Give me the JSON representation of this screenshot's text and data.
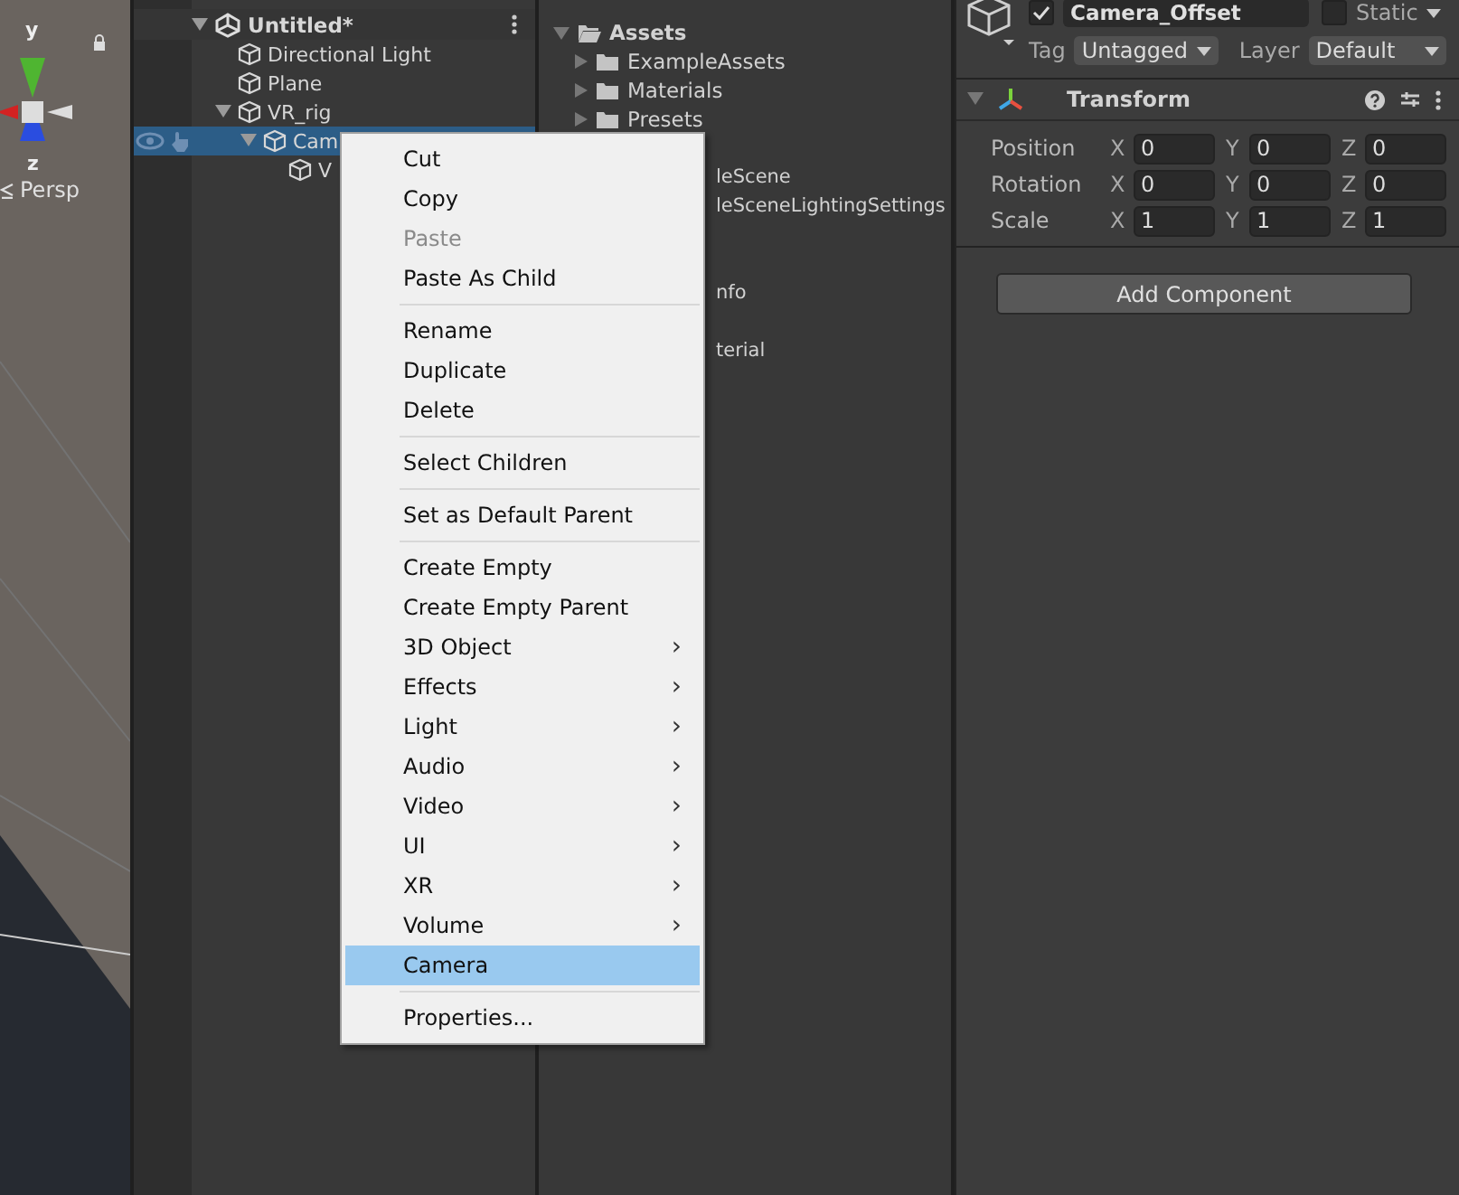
{
  "scene": {
    "axis_labels": [
      "y",
      "z"
    ],
    "projection": "Persp"
  },
  "hierarchy": {
    "scene": "Untitled*",
    "items": [
      {
        "label": "Directional Light",
        "selected": false
      },
      {
        "label": "Plane",
        "selected": false
      },
      {
        "label": "VR_rig",
        "expanded": true,
        "selected": false,
        "children": [
          {
            "label": "Cam",
            "expanded": true,
            "selected": true,
            "children": [
              {
                "label": "V",
                "selected": false
              }
            ]
          }
        ]
      }
    ]
  },
  "project": {
    "root": "Assets",
    "folders": [
      "ExampleAssets",
      "Materials",
      "Presets"
    ],
    "partial_items": [
      "leScene",
      "leSceneLightingSettings",
      "nfo",
      "terial"
    ]
  },
  "context_menu": [
    {
      "kind": "item",
      "label": "Cut",
      "disabled": false,
      "submenu": false,
      "selected": false
    },
    {
      "kind": "item",
      "label": "Copy",
      "disabled": false,
      "submenu": false,
      "selected": false
    },
    {
      "kind": "item",
      "label": "Paste",
      "disabled": true,
      "submenu": false,
      "selected": false
    },
    {
      "kind": "item",
      "label": "Paste As Child",
      "disabled": false,
      "submenu": false,
      "selected": false
    },
    {
      "kind": "separator"
    },
    {
      "kind": "item",
      "label": "Rename",
      "disabled": false,
      "submenu": false,
      "selected": false
    },
    {
      "kind": "item",
      "label": "Duplicate",
      "disabled": false,
      "submenu": false,
      "selected": false
    },
    {
      "kind": "item",
      "label": "Delete",
      "disabled": false,
      "submenu": false,
      "selected": false
    },
    {
      "kind": "separator"
    },
    {
      "kind": "item",
      "label": "Select Children",
      "disabled": false,
      "submenu": false,
      "selected": false
    },
    {
      "kind": "separator"
    },
    {
      "kind": "item",
      "label": "Set as Default Parent",
      "disabled": false,
      "submenu": false,
      "selected": false
    },
    {
      "kind": "separator"
    },
    {
      "kind": "item",
      "label": "Create Empty",
      "disabled": false,
      "submenu": false,
      "selected": false
    },
    {
      "kind": "item",
      "label": "Create Empty Parent",
      "disabled": false,
      "submenu": false,
      "selected": false
    },
    {
      "kind": "item",
      "label": "3D Object",
      "disabled": false,
      "submenu": true,
      "selected": false
    },
    {
      "kind": "item",
      "label": "Effects",
      "disabled": false,
      "submenu": true,
      "selected": false
    },
    {
      "kind": "item",
      "label": "Light",
      "disabled": false,
      "submenu": true,
      "selected": false
    },
    {
      "kind": "item",
      "label": "Audio",
      "disabled": false,
      "submenu": true,
      "selected": false
    },
    {
      "kind": "item",
      "label": "Video",
      "disabled": false,
      "submenu": true,
      "selected": false
    },
    {
      "kind": "item",
      "label": "UI",
      "disabled": false,
      "submenu": true,
      "selected": false
    },
    {
      "kind": "item",
      "label": "XR",
      "disabled": false,
      "submenu": true,
      "selected": false
    },
    {
      "kind": "item",
      "label": "Volume",
      "disabled": false,
      "submenu": true,
      "selected": false
    },
    {
      "kind": "item",
      "label": "Camera",
      "disabled": false,
      "submenu": false,
      "selected": true
    },
    {
      "kind": "separator"
    },
    {
      "kind": "item",
      "label": "Properties...",
      "disabled": false,
      "submenu": false,
      "selected": false
    }
  ],
  "submenu_glyph": "›",
  "inspector": {
    "active": true,
    "name": "Camera_Offset",
    "static": false,
    "static_label": "Static",
    "tag_label": "Tag",
    "tag": "Untagged",
    "layer_label": "Layer",
    "layer": "Default",
    "component": {
      "title": "Transform",
      "expanded": true,
      "rows": [
        {
          "label": "Position",
          "fields": [
            {
              "axis": "X",
              "value": "0"
            },
            {
              "axis": "Y",
              "value": "0"
            },
            {
              "axis": "Z",
              "value": "0"
            }
          ]
        },
        {
          "label": "Rotation",
          "fields": [
            {
              "axis": "X",
              "value": "0"
            },
            {
              "axis": "Y",
              "value": "0"
            },
            {
              "axis": "Z",
              "value": "0"
            }
          ]
        },
        {
          "label": "Scale",
          "fields": [
            {
              "axis": "X",
              "value": "1"
            },
            {
              "axis": "Y",
              "value": "1"
            },
            {
              "axis": "Z",
              "value": "1"
            }
          ]
        }
      ]
    },
    "add_button": "Add Component"
  }
}
